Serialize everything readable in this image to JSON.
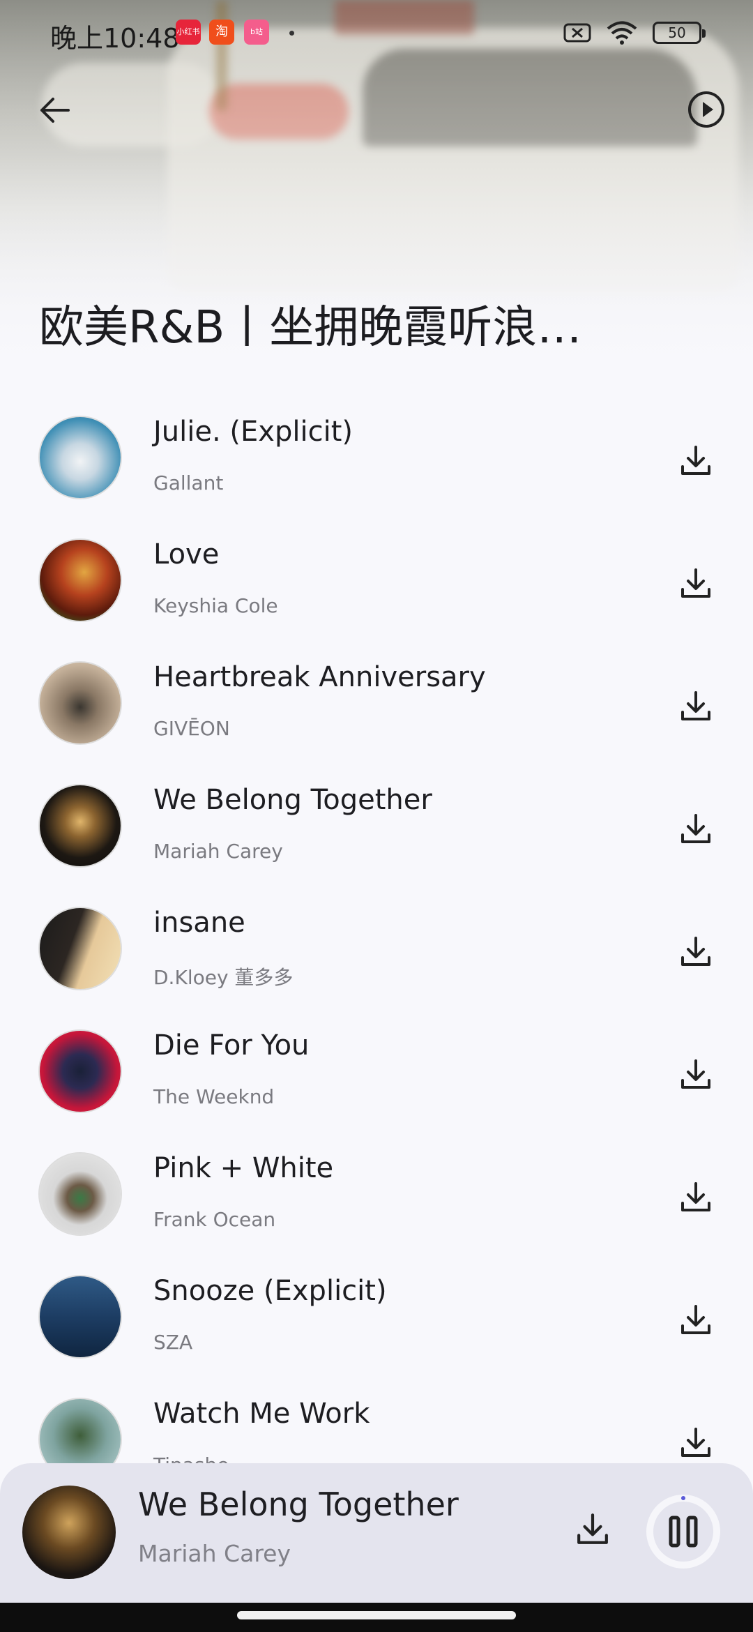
{
  "status_bar": {
    "time": "晚上10:48",
    "apps": [
      "小红书",
      "淘",
      "b站"
    ],
    "battery": "50"
  },
  "header": {
    "playlist_title": "欧美R&B丨坐拥晚霞听浪…"
  },
  "songs": [
    {
      "title": "Julie. (Explicit)",
      "artist": "Gallant"
    },
    {
      "title": "Love",
      "artist": "Keyshia Cole"
    },
    {
      "title": "Heartbreak Anniversary",
      "artist": "GIVĒON"
    },
    {
      "title": "We Belong Together",
      "artist": "Mariah Carey"
    },
    {
      "title": "insane",
      "artist": "D.Kloey 董多多"
    },
    {
      "title": "Die For You",
      "artist": "The Weeknd"
    },
    {
      "title": "Pink + White",
      "artist": "Frank Ocean"
    },
    {
      "title": "Snooze (Explicit)",
      "artist": "SZA"
    },
    {
      "title": "Watch Me Work",
      "artist": "Tinashe"
    }
  ],
  "now_playing": {
    "title": "We Belong Together",
    "artist": "Mariah Carey"
  },
  "colors": {
    "background": "#f8f8fc",
    "player_bg": "#e4e4ee",
    "title_text": "#1d1d21",
    "artist_text": "#7a7a80"
  },
  "icons": {
    "back": "arrow-left-icon",
    "play_all": "play-circle-icon",
    "download": "download-icon",
    "pause": "pause-icon"
  }
}
